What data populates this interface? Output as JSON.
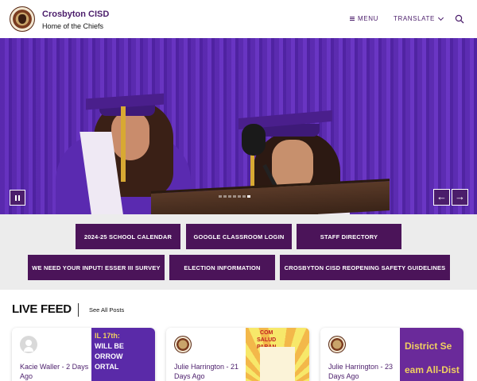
{
  "header": {
    "site_name": "Crosbyton CISD",
    "tagline": "Home of the Chiefs",
    "menu_label": "MENU",
    "translate_label": "TRANSLATE"
  },
  "icons": {
    "logo": "school-logo",
    "menu": "hamburger-icon",
    "translate": "chevron-down-icon",
    "search": "search-icon",
    "pause": "pause-icon",
    "prev": "arrow-left-icon",
    "next": "arrow-right-icon"
  },
  "hero": {
    "prev_glyph": "←",
    "next_glyph": "→",
    "slide_count": 7,
    "active_slide": 6
  },
  "quick_links": [
    "2024-25 SCHOOL CALENDAR",
    "GOOGLE CLASSROOM LOGIN",
    "STAFF DIRECTORY",
    "WE NEED YOUR INPUT! ESSER III SURVEY",
    "ELECTION INFORMATION",
    "CROSBYTON CISD REOPENING SAFETY GUIDELINES"
  ],
  "live_feed": {
    "title": "LIVE FEED",
    "see_all": "See All Posts",
    "posts": [
      {
        "author": "Kacie Waller - 2 Days Ago",
        "image_lines": [
          "IL 17th:",
          "WILL BE",
          "ORROW",
          "ORTAL"
        ]
      },
      {
        "author": "Julie Harrington - 21 Days Ago",
        "image_lines": [
          "COM",
          "SALUD",
          "PARAN"
        ]
      },
      {
        "author": "Julie Harrington - 23 Days Ago",
        "image_lines": [
          "District Se",
          "eam All-Dist"
        ]
      }
    ]
  },
  "colors": {
    "brand_purple": "#4b1d6b",
    "button_purple": "#4b1459",
    "quicklinks_bg": "#ececec"
  }
}
